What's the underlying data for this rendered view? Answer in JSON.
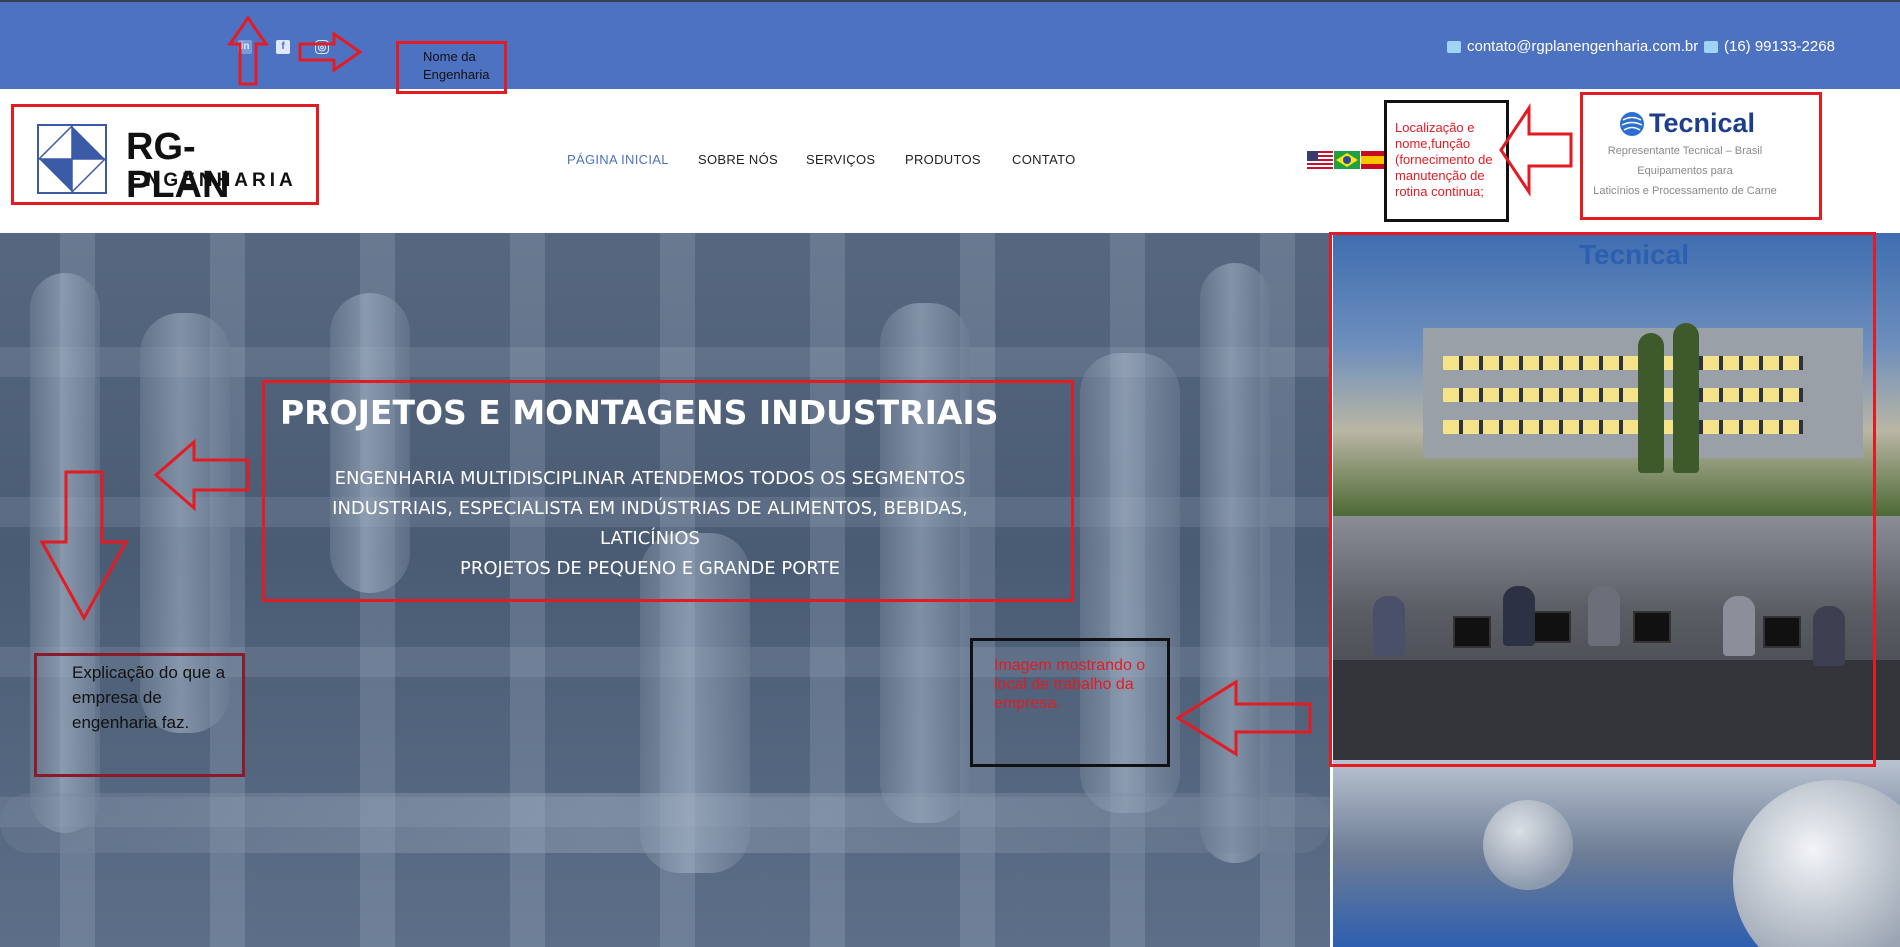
{
  "topbar": {
    "social": [
      {
        "name": "linkedin",
        "icon": "linkedin-icon",
        "glyph": "in"
      },
      {
        "name": "facebook",
        "icon": "facebook-icon",
        "glyph": "f"
      },
      {
        "name": "instagram",
        "icon": "instagram-icon",
        "glyph": "◎"
      }
    ],
    "email": "contato@rgplanengenharia.com.br",
    "phone": "(16) 99133-2268",
    "background_color": "#4e72c2"
  },
  "annotations": {
    "company_name_note": "Nome da Engenharia",
    "location_note": "Localização e nome,função (fornecimento de manutenção  de rotina continua;",
    "explanation_note": "Explicação do que a empresa de engenharia faz.",
    "image_note": "Imagem mostrando o local de trabalho da empresa."
  },
  "logo": {
    "title": "RG-PLAN",
    "subtitle": "ENGENHARIA"
  },
  "nav": {
    "items": [
      {
        "label": "PÁGINA INICIAL",
        "active": true
      },
      {
        "label": "SOBRE NÓS",
        "active": false
      },
      {
        "label": "SERVIÇOS",
        "active": false
      },
      {
        "label": "PRODUTOS",
        "active": false
      },
      {
        "label": "CONTATO",
        "active": false
      }
    ],
    "active_color": "#4e72c2"
  },
  "languages": [
    {
      "name": "english",
      "icon": "us-flag-icon"
    },
    {
      "name": "portuguese",
      "icon": "brazil-flag-icon"
    },
    {
      "name": "spanish",
      "icon": "spain-flag-icon"
    }
  ],
  "partner": {
    "name": "Tecnical",
    "line1": "Representante Tecnical – Brasil",
    "line2": "Equipamentos para",
    "line3": "Laticínios e Processamento de Carne"
  },
  "hero": {
    "title": "PROJETOS E MONTAGENS INDUSTRIAIS",
    "line1": "ENGENHARIA MULTIDISCIPLINAR ATENDEMOS TODOS OS SEGMENTOS",
    "line2": "INDUSTRIAIS, ESPECIALISTA EM INDÚSTRIAS DE ALIMENTOS, BEBIDAS,",
    "line3": "LATICÍNIOS",
    "line4": "PROJETOS DE PEQUENO E GRANDE PORTE"
  },
  "photos": {
    "building_sign": "Tecnical"
  },
  "colors": {
    "annotation_red": "#e31b23",
    "tecnical_blue": "#1c3e8c"
  }
}
